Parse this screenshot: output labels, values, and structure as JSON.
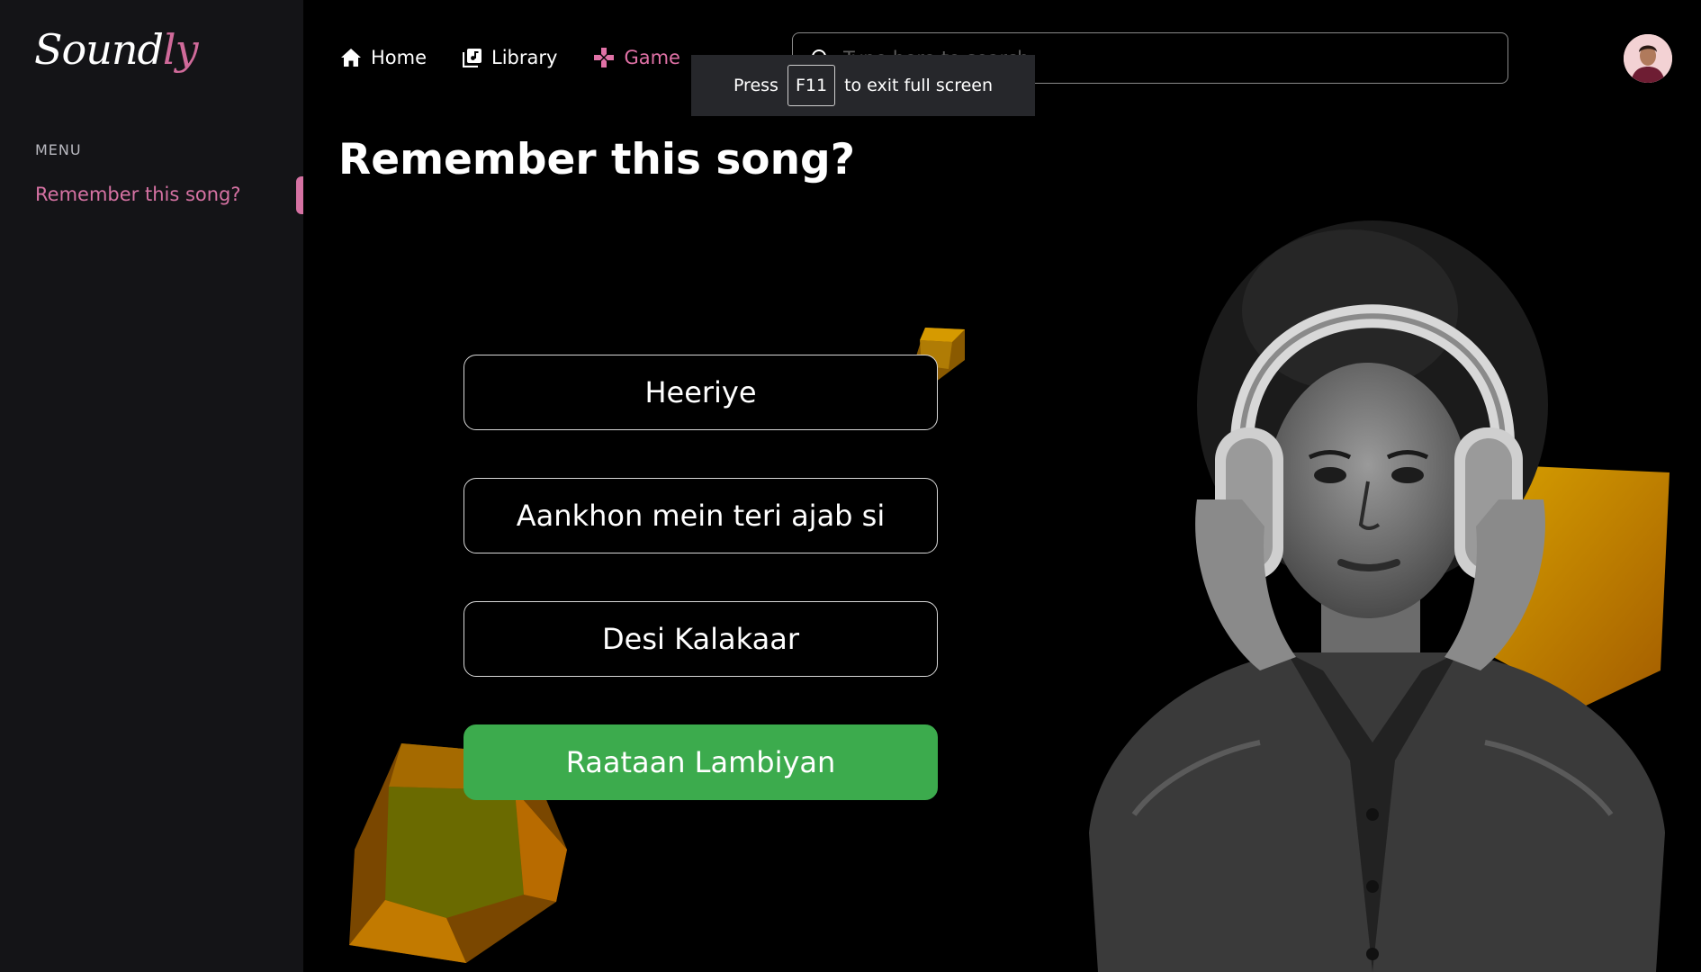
{
  "app": {
    "logo_main": "Sound",
    "logo_accent": "ly"
  },
  "sidebar": {
    "heading": "MENU",
    "items": [
      {
        "label": "Remember this song?",
        "active": true
      }
    ]
  },
  "nav": {
    "items": [
      {
        "label": "Home",
        "icon": "home-icon"
      },
      {
        "label": "Library",
        "icon": "library-icon"
      },
      {
        "label": "Game",
        "icon": "gamepad-icon",
        "active": true
      }
    ]
  },
  "search": {
    "placeholder": "Type here to search",
    "value": ""
  },
  "toast": {
    "prefix": "Press",
    "key": "F11",
    "suffix": "to exit full screen"
  },
  "page": {
    "title": "Remember this song?"
  },
  "quiz": {
    "options": [
      {
        "label": "Heeriye",
        "state": "default"
      },
      {
        "label": "Aankhon mein teri ajab si",
        "state": "default"
      },
      {
        "label": "Desi Kalakaar",
        "state": "default"
      },
      {
        "label": "Raataan Lambiyan",
        "state": "correct"
      }
    ]
  },
  "colors": {
    "accent": "#d672a3",
    "correct": "#3cab4d",
    "sidebar_bg": "#141417",
    "background": "#000000"
  }
}
